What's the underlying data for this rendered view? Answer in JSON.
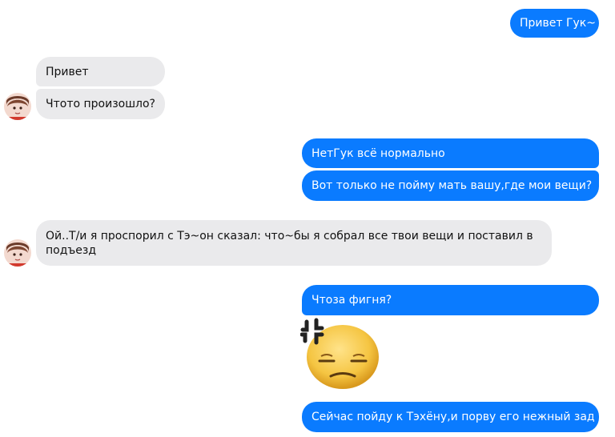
{
  "colors": {
    "outgoing": "#0a7bff",
    "incoming": "#eaeaec"
  },
  "messages": [
    {
      "direction": "outgoing",
      "text": "Привет Гук~"
    },
    {
      "direction": "incoming",
      "text": "Привет"
    },
    {
      "direction": "incoming",
      "text": "Чтото произошло?"
    },
    {
      "direction": "outgoing",
      "text": "НетГук всё нормально"
    },
    {
      "direction": "outgoing",
      "text": "Вот только не пойму мать вашу,где мои вещи?"
    },
    {
      "direction": "incoming",
      "text": "Ой..Т/и я проспорил с Тэ~он сказал: что~бы я собрал все твои вещи и поставил в подъезд"
    },
    {
      "direction": "outgoing",
      "text": "Чтоза фигня?"
    },
    {
      "direction": "outgoing",
      "sticker": "annoyed-face-emoji"
    },
    {
      "direction": "outgoing",
      "text": "Сейчас пойду к Тэхёну,и порву его нежный зад"
    }
  ],
  "icons": {
    "avatar": "contact-avatar",
    "sticker": "annoyed-face-emoji"
  }
}
